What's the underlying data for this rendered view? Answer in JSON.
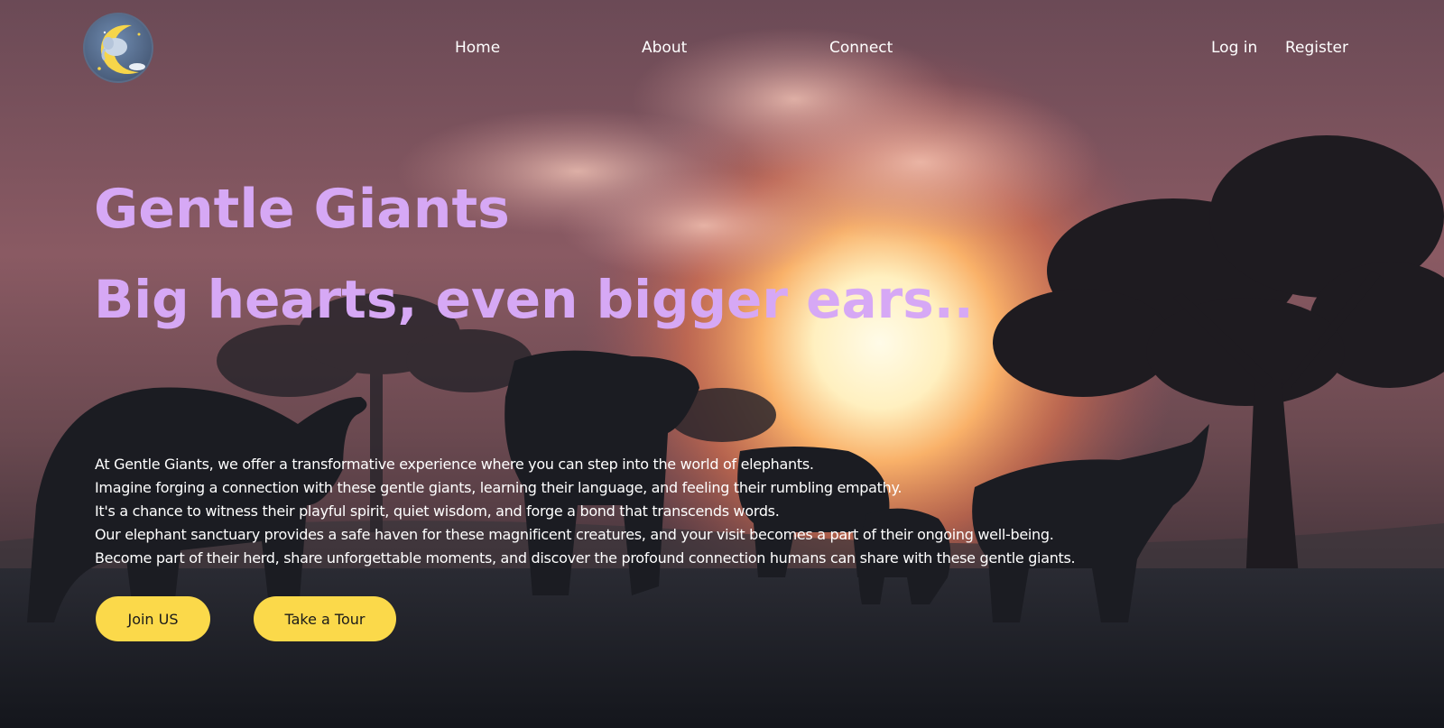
{
  "nav": {
    "logo_alt_icon": "elephant-on-moon-logo",
    "links": [
      "Home",
      "About",
      "Connect"
    ],
    "login": "Log in",
    "register": "Register"
  },
  "hero": {
    "title": "Gentle Giants",
    "tagline": "Big hearts, even bigger ears..",
    "description": [
      "At Gentle Giants, we offer a transformative experience where you can step into the world of elephants.",
      "Imagine forging a connection with these gentle giants, learning their language, and feeling their rumbling empathy.",
      "It's a chance to witness their playful spirit, quiet wisdom, and forge a bond that transcends words.",
      "Our elephant sanctuary provides a safe haven for these magnificent creatures, and your visit becomes a part of their ongoing well-being.",
      "Become part of their herd, share unforgettable moments, and discover the profound connection humans can share with these gentle giants."
    ],
    "buttons": {
      "join": "Join US",
      "tour": "Take a Tour"
    }
  },
  "colors": {
    "title": "#d6a8f5",
    "button": "#fbd94a",
    "background": "#14161c"
  }
}
